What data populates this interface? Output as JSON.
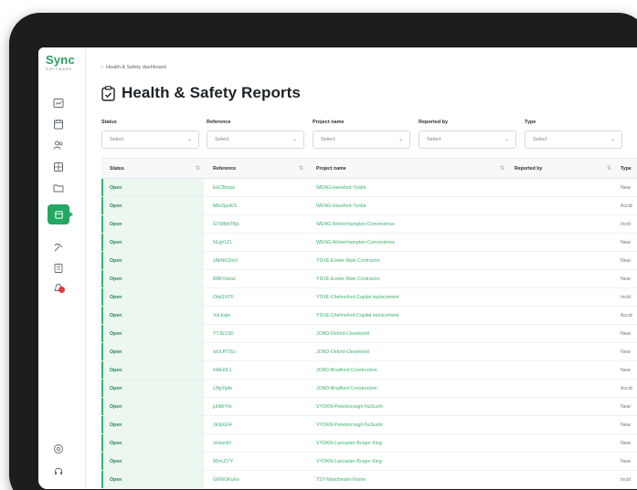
{
  "app": {
    "logo": "Sync",
    "logo_sub": "SOFTWARE"
  },
  "breadcrumb": "Health & Safety dashboard",
  "page_title": "Health & Safety Reports",
  "filters": [
    {
      "label": "Status",
      "value": "Select"
    },
    {
      "label": "Reference",
      "value": "Select"
    },
    {
      "label": "Project name",
      "value": "Select"
    },
    {
      "label": "Reported by",
      "value": "Select"
    },
    {
      "label": "Type",
      "value": "Select"
    }
  ],
  "table": {
    "headers": [
      "Status",
      "Reference",
      "Project name",
      "Reported by",
      "Type"
    ],
    "rows": [
      {
        "status": "Open",
        "ref": "EkC8mqsj",
        "project": "WENG-Havefoot-Tyrdla",
        "type": "Near"
      },
      {
        "status": "Open",
        "ref": "MbxSpuKS",
        "project": "WENG-Havefoot-Tyrdla",
        "type": "Accid"
      },
      {
        "status": "Open",
        "ref": "GTMMdTBjc",
        "project": "WENG-Wolverhampton-Convenience",
        "type": "Incid"
      },
      {
        "status": "Open",
        "ref": "NLgh1ZL",
        "project": "WENG-Wolverhampton-Convenience",
        "type": "Near"
      },
      {
        "status": "Open",
        "ref": "zAkNKZmU",
        "project": "YDVE-Exeter-Main Contractor",
        "type": "Near"
      },
      {
        "status": "Open",
        "ref": "BBKVlanw",
        "project": "YDVE-Exeter-Main Contractor",
        "type": "Near"
      },
      {
        "status": "Open",
        "ref": "OtqGVt7F",
        "project": "YDVE-Chelmsford-Capital replacement",
        "type": "Incid"
      },
      {
        "status": "Open",
        "ref": "VoLkxjie",
        "project": "YDVE-Chelmsford-Capital replacement",
        "type": "Accid"
      },
      {
        "status": "Open",
        "ref": "YTJE1SD",
        "project": "JOND-Oxford-Clearworld",
        "type": "Near"
      },
      {
        "status": "Open",
        "ref": "wOLRT0Lt",
        "project": "JOND-Oxford-Clearworld",
        "type": "Near"
      },
      {
        "status": "Open",
        "ref": "HAEkfL1",
        "project": "JOND-Bradford-Construction",
        "type": "Near"
      },
      {
        "status": "Open",
        "ref": "U9gYqde",
        "project": "JOND-Bradford-Construction",
        "type": "Accid"
      },
      {
        "status": "Open",
        "ref": "juhMrYrk",
        "project": "VYOKN-Peterborough-NuSushi",
        "type": "Near"
      },
      {
        "status": "Open",
        "ref": "Jk3pG64",
        "project": "VYOKN-Peterborough-NuSushi",
        "type": "Near"
      },
      {
        "status": "Open",
        "ref": "nHiamiD",
        "project": "VYOKN-Lancaster-Burger King",
        "type": "Near"
      },
      {
        "status": "Open",
        "ref": "85rrLD7Y",
        "project": "VYOKN-Lancaster-Burger King",
        "type": "Near"
      },
      {
        "status": "Open",
        "ref": "GMNOKuKe",
        "project": "TSY-Manchester-Nome",
        "type": "Incid"
      }
    ]
  },
  "colors": {
    "brand": "#22a862",
    "status_bg": "#ecf7f0",
    "link": "#3bb26f"
  },
  "sidebar_icons": [
    "dashboard-icon",
    "calendar-icon",
    "people-icon",
    "document-icon",
    "folder-icon",
    "health-safety-icon",
    "tools-icon",
    "checklist-icon",
    "alerts-icon",
    "settings-icon",
    "help-icon"
  ]
}
